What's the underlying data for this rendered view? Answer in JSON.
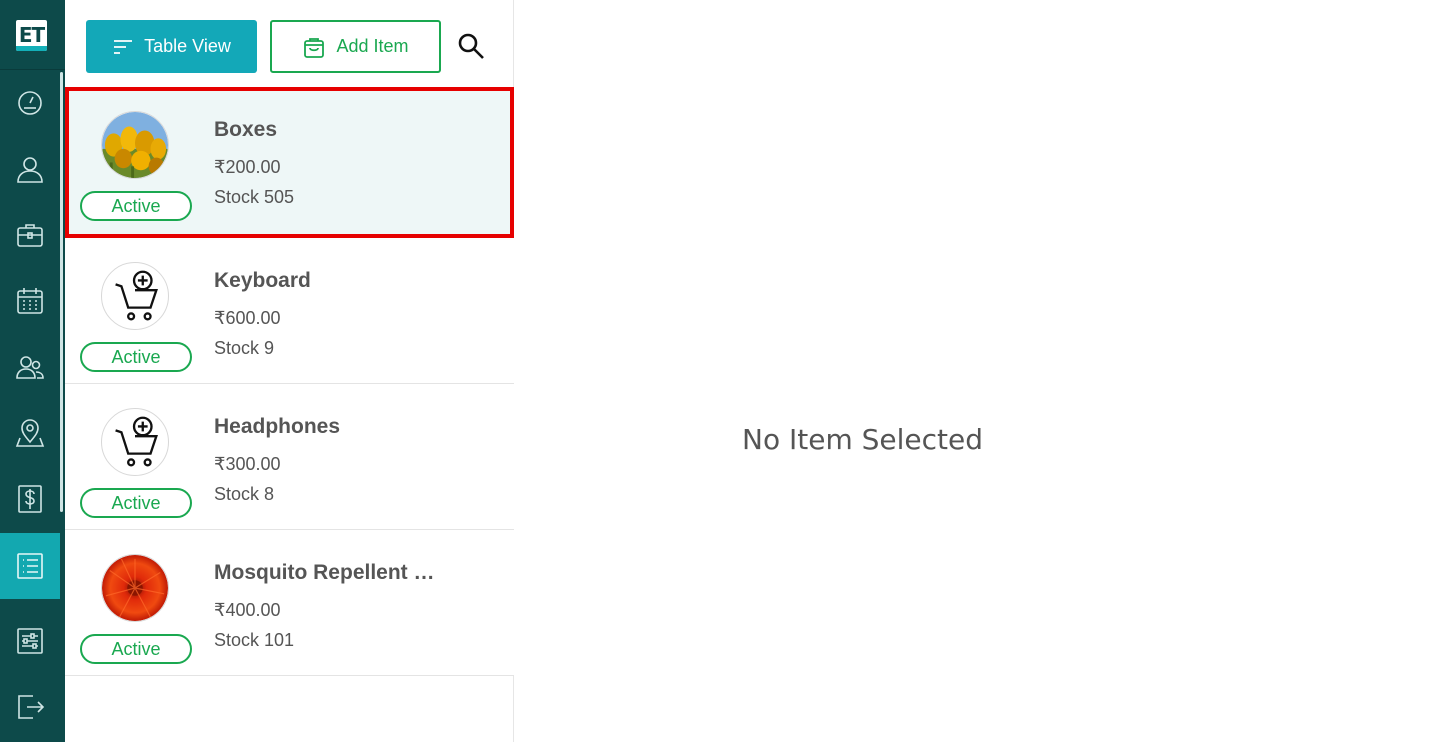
{
  "sidebar": {
    "logo_text": "ET",
    "nav": [
      {
        "icon": "dashboard-gauge-icon"
      },
      {
        "icon": "user-icon"
      },
      {
        "icon": "briefcase-icon"
      },
      {
        "icon": "calendar-icon"
      },
      {
        "icon": "users-icon"
      },
      {
        "icon": "map-pin-icon"
      },
      {
        "icon": "dollar-icon"
      },
      {
        "icon": "list-icon",
        "active": true
      },
      {
        "icon": "settings-sliders-icon"
      },
      {
        "icon": "logout-icon"
      }
    ]
  },
  "toolbar": {
    "table_view_label": "Table View",
    "add_item_label": "Add Item"
  },
  "items": [
    {
      "name": "Boxes",
      "price": "₹200.00",
      "stock": "Stock 505",
      "status": "Active",
      "image": "yellow-tulips-photo"
    },
    {
      "name": "Keyboard",
      "price": "₹600.00",
      "stock": "Stock 9",
      "status": "Active",
      "image": "cart-add-icon"
    },
    {
      "name": "Headphones",
      "price": "₹300.00",
      "stock": "Stock 8",
      "status": "Active",
      "image": "cart-add-icon"
    },
    {
      "name": "Mosquito Repellent …",
      "price": "₹400.00",
      "stock": "Stock 101",
      "status": "Active",
      "image": "red-flower-photo"
    }
  ],
  "detail": {
    "empty_message": "No Item Selected"
  },
  "colors": {
    "sidebar": "#0d4a4a",
    "accent": "#13a8b8",
    "active_green": "#1aa850",
    "selection_border": "#e60000"
  }
}
